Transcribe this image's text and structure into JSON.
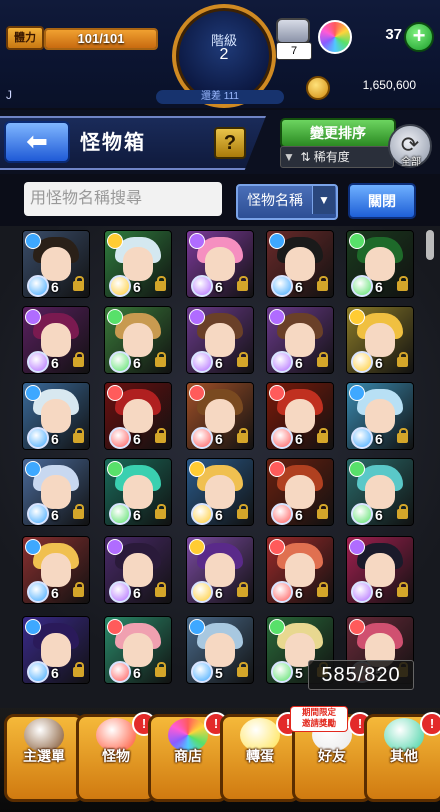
{
  "status": {
    "stamina_label": "體力",
    "stamina_text": "101/101",
    "stamina_fraction": 1.0,
    "rank_label": "階級",
    "rank_value": "2",
    "rank_diff_text": "還差 111",
    "ticket_count": "7",
    "orb_count": "37",
    "plus_label": "+",
    "player_name": "J",
    "coin_amount": "1,650,600"
  },
  "header": {
    "title": "怪物箱",
    "help_label": "?",
    "sort_button_label": "變更排序",
    "sort_current": "稀有度",
    "refresh_label": "全部"
  },
  "search": {
    "placeholder": "用怪物名稱搜尋",
    "field_selected": "怪物名稱",
    "close_label": "關閉"
  },
  "box": {
    "count_text": "585/820",
    "monsters": [
      {
        "level": "6",
        "element": "#3ea8ff",
        "hair": "#2a2018",
        "bg": "#3a4d6a"
      },
      {
        "level": "6",
        "element": "#ffcc33",
        "hair": "#d4e8f0",
        "bg": "#2f7d3e"
      },
      {
        "level": "6",
        "element": "#b06cff",
        "hair": "#f58fc0",
        "bg": "#7c3a9a"
      },
      {
        "level": "6",
        "element": "#3ea8ff",
        "hair": "#1a1a1a",
        "bg": "#6a2a2a"
      },
      {
        "level": "6",
        "element": "#58e06a",
        "hair": "#1e6a2a",
        "bg": "#1a3a1e"
      },
      {
        "level": "6",
        "element": "#b06cff",
        "hair": "#7a1a50",
        "bg": "#5a2060"
      },
      {
        "level": "6",
        "element": "#58e06a",
        "hair": "#c89a50",
        "bg": "#3a7a3a"
      },
      {
        "level": "6",
        "element": "#b06cff",
        "hair": "#6a4028",
        "bg": "#6a3a8a"
      },
      {
        "level": "6",
        "element": "#b06cff",
        "hair": "#6a4028",
        "bg": "#6a3a8a"
      },
      {
        "level": "6",
        "element": "#ffcc33",
        "hair": "#f0c040",
        "bg": "#8a7a28"
      },
      {
        "level": "6",
        "element": "#3ea8ff",
        "hair": "#d8e8f0",
        "bg": "#3a6a9a"
      },
      {
        "level": "6",
        "element": "#ff5b5b",
        "hair": "#b02020",
        "bg": "#6a1010"
      },
      {
        "level": "6",
        "element": "#ff5b5b",
        "hair": "#7a4a20",
        "bg": "#a05028"
      },
      {
        "level": "6",
        "element": "#ff5b5b",
        "hair": "#c03020",
        "bg": "#7a1a0a"
      },
      {
        "level": "6",
        "element": "#3ea8ff",
        "hair": "#b8e0f5",
        "bg": "#3a8ab0"
      },
      {
        "level": "6",
        "element": "#3ea8ff",
        "hair": "#c8d8f0",
        "bg": "#4a6a9a"
      },
      {
        "level": "6",
        "element": "#58e06a",
        "hair": "#3ad0b0",
        "bg": "#1a6a5a"
      },
      {
        "level": "6",
        "element": "#ffcc33",
        "hair": "#f0c050",
        "bg": "#2a5a8a"
      },
      {
        "level": "6",
        "element": "#ff5b5b",
        "hair": "#b04020",
        "bg": "#6a2010"
      },
      {
        "level": "6",
        "element": "#58e06a",
        "hair": "#5ac8c8",
        "bg": "#2a6a6a"
      },
      {
        "level": "6",
        "element": "#3ea8ff",
        "hair": "#f0c050",
        "bg": "#8a3030"
      },
      {
        "level": "6",
        "element": "#b06cff",
        "hair": "#2a1a3a",
        "bg": "#4a2a6a"
      },
      {
        "level": "6",
        "element": "#ffcc33",
        "hair": "#5a2a8a",
        "bg": "#7a4aa0"
      },
      {
        "level": "6",
        "element": "#ff5b5b",
        "hair": "#e07050",
        "bg": "#9a2a2a"
      },
      {
        "level": "6",
        "element": "#b06cff",
        "hair": "#1a1a2a",
        "bg": "#a02050"
      },
      {
        "level": "6",
        "element": "#3ea8ff",
        "hair": "#2a1a5a",
        "bg": "#3a2a8a"
      },
      {
        "level": "6",
        "element": "#ff5b5b",
        "hair": "#f0a0b0",
        "bg": "#2a8a6a"
      },
      {
        "level": "5",
        "element": "#3ea8ff",
        "hair": "#a8c8e0",
        "bg": "#4a6a8a"
      },
      {
        "level": "5",
        "element": "#58e06a",
        "hair": "#e8d890",
        "bg": "#2a6a3a"
      },
      {
        "level": "5",
        "element": "#ff5b5b",
        "hair": "#d05070",
        "bg": "#6a2a3a"
      }
    ]
  },
  "nav": {
    "items": [
      {
        "label": "主選單",
        "icon": "house-icon",
        "badge": ""
      },
      {
        "label": "怪物",
        "icon": "monster-icon",
        "badge": "!"
      },
      {
        "label": "商店",
        "icon": "orb-icon",
        "badge": "!"
      },
      {
        "label": "轉蛋",
        "icon": "gacha-icon",
        "badge": "!"
      },
      {
        "label": "好友",
        "icon": "friends-icon",
        "badge": "!"
      },
      {
        "label": "其他",
        "icon": "question-icon",
        "badge": "!"
      }
    ],
    "promo_line1": "期間限定",
    "promo_line2": "邀請獎勵"
  },
  "colors": {
    "accent_green": "#2b8a22",
    "accent_blue": "#1e5fd6",
    "nav_orange": "#d07a10"
  }
}
